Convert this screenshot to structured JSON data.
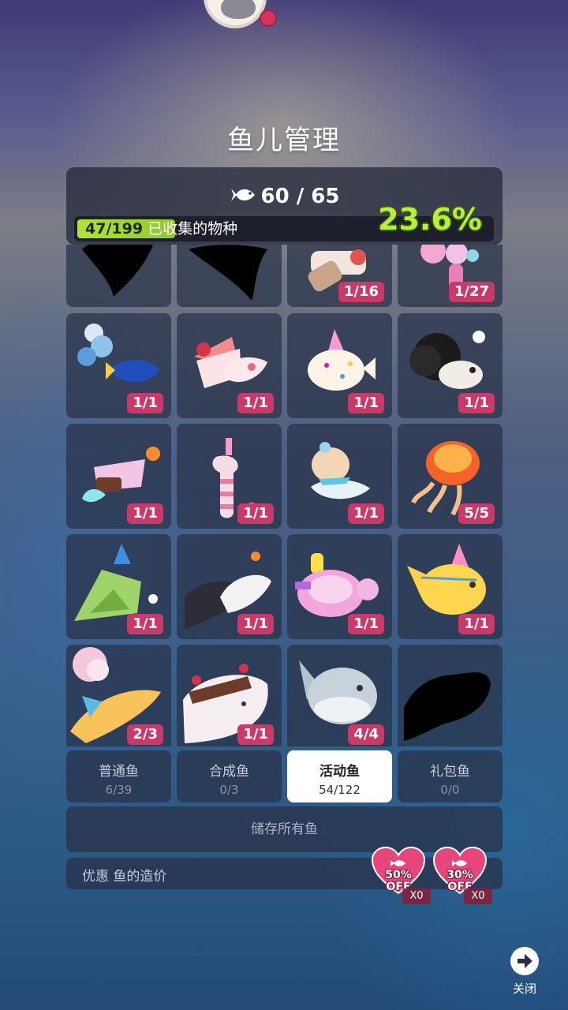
{
  "title": "鱼儿管理",
  "header": {
    "fish_count": "60 / 65",
    "collected_num": "47/199",
    "collected_label": "已收集的物种",
    "percent": "23.6%",
    "progress": 0.236
  },
  "fish_cells": [
    {
      "badge": "",
      "icon": "silhouette-fish-1"
    },
    {
      "badge": "",
      "icon": "silhouette-fish-2"
    },
    {
      "badge": "1/16",
      "icon": "cake-fish"
    },
    {
      "badge": "1/27",
      "icon": "ribbon-fish"
    },
    {
      "badge": "1/1",
      "icon": "balloon-tang-fish"
    },
    {
      "badge": "1/1",
      "icon": "strawberry-cake-fish"
    },
    {
      "badge": "1/1",
      "icon": "party-hat-pufferfish"
    },
    {
      "badge": "1/1",
      "icon": "afro-fish"
    },
    {
      "badge": "1/1",
      "icon": "cocktail-squid"
    },
    {
      "badge": "1/1",
      "icon": "candle-seahorse"
    },
    {
      "badge": "1/1",
      "icon": "bow-creature"
    },
    {
      "badge": "5/5",
      "icon": "jellyfish"
    },
    {
      "badge": "1/1",
      "icon": "party-hat-green-fish"
    },
    {
      "badge": "1/1",
      "icon": "cocktail-dolphin"
    },
    {
      "badge": "1/1",
      "icon": "pink-turtle"
    },
    {
      "badge": "1/1",
      "icon": "party-hat-sunfish"
    },
    {
      "badge": "2/3",
      "icon": "balloon-yellow-fish"
    },
    {
      "badge": "1/1",
      "icon": "cake-whale"
    },
    {
      "badge": "4/4",
      "icon": "round-fish"
    },
    {
      "badge": "",
      "icon": "silhouette-whale"
    }
  ],
  "tabs": [
    {
      "label": "普通鱼",
      "count": "6/39"
    },
    {
      "label": "合成鱼",
      "count": "0/3"
    },
    {
      "label": "活动鱼",
      "count": "54/122"
    },
    {
      "label": "礼包鱼",
      "count": "0/0"
    }
  ],
  "store_all": "储存所有鱼",
  "discount_label": "优惠 鱼的造价",
  "coupons": [
    {
      "text": "50%\nOFF",
      "line1": "50%",
      "line2": "OFF",
      "qty": "X0"
    },
    {
      "text": "30%\nOFF",
      "line1": "30%",
      "line2": "OFF",
      "qty": "X0"
    }
  ],
  "close_label": "关闭",
  "colors": {
    "badge": "#c93a68",
    "progress_fill": "#b3e23b",
    "percent_text": "#b5f03a",
    "coupon_heart": "#e8457d"
  }
}
